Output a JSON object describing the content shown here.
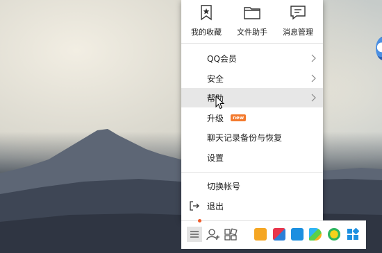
{
  "menu": {
    "shortcuts": [
      {
        "label": "我的收藏",
        "icon": "star-bookmark-icon"
      },
      {
        "label": "文件助手",
        "icon": "folder-icon"
      },
      {
        "label": "消息管理",
        "icon": "message-icon"
      }
    ],
    "items": [
      {
        "label": "QQ会员",
        "has_submenu": true
      },
      {
        "label": "安全",
        "has_submenu": true
      },
      {
        "label": "帮助",
        "has_submenu": true,
        "hovered": true
      },
      {
        "label": "升级",
        "badge": "new"
      },
      {
        "label": "聊天记录备份与恢复"
      },
      {
        "label": "设置"
      }
    ],
    "bottom_items": [
      {
        "label": "切换帐号"
      },
      {
        "label": "退出",
        "icon": "exit-icon"
      }
    ]
  },
  "toolbar": {
    "icons": [
      "menu-icon",
      "add-friend-icon",
      "app-manager-icon",
      "game-icon",
      "video-icon",
      "weiyun-icon",
      "tencent-video-icon",
      "qq-music-icon",
      "apps-grid-icon"
    ],
    "notification_dot_color": "#f05a28"
  },
  "colors": {
    "hover_bg": "#e7e7e7",
    "badge_bg": "#f37a2e"
  }
}
